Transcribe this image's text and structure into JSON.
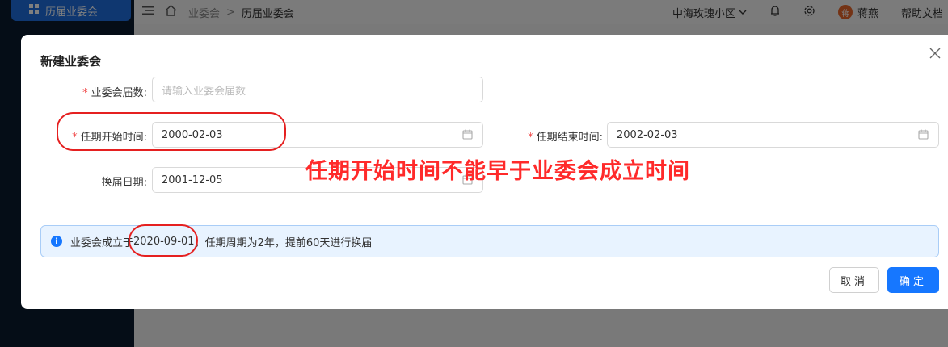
{
  "sidebar": {
    "active_item": "历届业委会"
  },
  "topbar": {
    "breadcrumb_root": "业委会",
    "breadcrumb_sep": ">",
    "breadcrumb_current": "历届业委会",
    "community": "中海玫瑰小区",
    "user_avatar": "蒋",
    "user_name": "蒋燕",
    "help": "帮助文档"
  },
  "dialog": {
    "title": "新建业委会",
    "fields": {
      "term_number": {
        "label": "业委会届数:",
        "placeholder": "请输入业委会届数",
        "value": ""
      },
      "term_start": {
        "label": "任期开始时间:",
        "value": "2000-02-03"
      },
      "term_end": {
        "label": "任期结束时间:",
        "value": "2002-02-03"
      },
      "renewal_date": {
        "label": "换届日期:",
        "value": "2001-12-05"
      }
    },
    "alert": {
      "prefix": "业委会成立于",
      "founded_date": "2020-09-01",
      "suffix": "，任期周期为2年，提前60天进行换届"
    },
    "buttons": {
      "cancel": "取消",
      "ok": "确定"
    }
  },
  "annotation": {
    "text": "任期开始时间不能早于业委会成立时间",
    "color": "#ff2a2a"
  },
  "colors": {
    "primary": "#1677ff",
    "required": "#f04848",
    "alert_bg": "#e8f3ff"
  }
}
